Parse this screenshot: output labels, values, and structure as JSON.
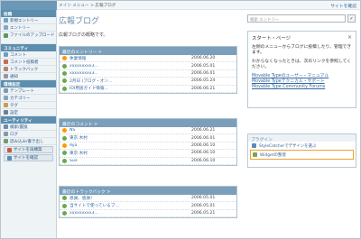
{
  "breadcrumb": {
    "home": "メイン メニュー",
    "sep": ">",
    "current": "広報ブログ"
  },
  "header": {
    "view_site": "サイトを確認"
  },
  "sidebar": {
    "sections": [
      {
        "title": "投稿",
        "items": [
          {
            "label": "新規エントリー",
            "icon": "new-entry-icon",
            "color": "#6fa3c7"
          },
          {
            "label": "エントリー",
            "icon": "entries-icon",
            "color": "#7fa9c8"
          },
          {
            "label": "ファイルのアップロード",
            "icon": "upload-icon",
            "color": "#5b9a5b"
          }
        ]
      },
      {
        "title": "コミュニティ",
        "items": [
          {
            "label": "コメント",
            "icon": "comment-icon",
            "color": "#6d9ec2"
          },
          {
            "label": "コメント投稿者",
            "icon": "commenters-icon",
            "color": "#c76c4f"
          },
          {
            "label": "トラックバック",
            "icon": "trackback-icon",
            "color": "#b5856a"
          },
          {
            "label": "通知",
            "icon": "notification-icon",
            "color": "#8e9aa6"
          }
        ]
      },
      {
        "title": "環境設定",
        "items": [
          {
            "label": "テンプレート",
            "icon": "template-icon",
            "color": "#7a9bb6"
          },
          {
            "label": "カテゴリー",
            "icon": "category-icon",
            "color": "#8aa4b9"
          },
          {
            "label": "タグ",
            "icon": "tag-icon",
            "color": "#c7a04f"
          },
          {
            "label": "設定",
            "icon": "settings-icon",
            "color": "#6f7f8c"
          }
        ]
      },
      {
        "title": "ユーティリティ",
        "items": [
          {
            "label": "検索/置換",
            "icon": "search-replace-icon",
            "color": "#6b8fab"
          },
          {
            "label": "ログ",
            "icon": "log-icon",
            "color": "#8a98a4"
          },
          {
            "label": "読み込み/書き出し",
            "icon": "import-export-icon",
            "color": "#6fa06f"
          }
        ]
      }
    ],
    "buttons": [
      {
        "label": "サイトを再構築",
        "icon": "rebuild-icon",
        "color": "#c85a3c"
      },
      {
        "label": "サイトを確認",
        "icon": "view-site-icon",
        "color": "#5b8bb0"
      }
    ]
  },
  "main": {
    "title": "広報ブログ",
    "description": "広報ブログの概略です。",
    "panels": [
      {
        "title": "最近のエントリー >",
        "rows": [
          {
            "label": "休業情報",
            "date": "2006.06.20",
            "color": "#ff9900"
          },
          {
            "label": "xxxxxxxxx3...",
            "date": "2006.05.01",
            "color": "#6aa84f"
          },
          {
            "label": "xxxxxxxxx3...",
            "date": "2006.06.01",
            "color": "#6aa84f"
          },
          {
            "label": "2月日 (ブログ・オン...",
            "date": "2006.05.24",
            "color": "#6aa84f"
          },
          {
            "label": "IOI用語ガイド情報...",
            "date": "2006.06.21",
            "color": "#6aa84f"
          }
        ]
      },
      {
        "title": "最近のコメント >",
        "rows": [
          {
            "label": "NS",
            "date": "2006.06.21",
            "color": "#ff9900"
          },
          {
            "label": "東京 木村",
            "date": "2006.06.01",
            "color": "#6aa84f"
          },
          {
            "label": "Aya",
            "date": "2006.06.10",
            "color": "#ff9900"
          },
          {
            "label": "東京 木村",
            "date": "2006.06.10",
            "color": "#6aa84f"
          },
          {
            "label": "Sue",
            "date": "2006.06.10",
            "color": "#6aa84f"
          }
        ]
      },
      {
        "title": "最近のトラックバック >",
        "rows": [
          {
            "label": "感謝、感謝！",
            "date": "2006.05.01",
            "color": "#6aa84f"
          },
          {
            "label": "当サイトで使っているブ...",
            "date": "2006.05.01",
            "color": "#6aa84f"
          },
          {
            "label": "xxxxxxxxx3...",
            "date": "2006.05.21",
            "color": "#6aa84f"
          }
        ]
      }
    ]
  },
  "right": {
    "search_placeholder": "検索 エントリー",
    "search_button": "✓",
    "start": {
      "title": "スタート・ページ",
      "text1": "左側のメニューからブログに投稿したり、管理できます。",
      "text2": "わからなくなったときは、次のリンクを参照してください。",
      "links": [
        "Movable Typeのユーザー・マニュアル",
        "Movable Typeテクニカル・サポート",
        "Movable Type Community Forums"
      ],
      "close": "×"
    },
    "plugins": {
      "title": "プラグイン",
      "items": [
        {
          "label": "StyleCatcherでデザインを選ぶ",
          "icon": "stylecatcher-icon",
          "color": "#5b8bb0"
        },
        {
          "label": "Widgetの整理",
          "icon": "widget-icon",
          "color": "#7aa35b"
        }
      ]
    }
  }
}
